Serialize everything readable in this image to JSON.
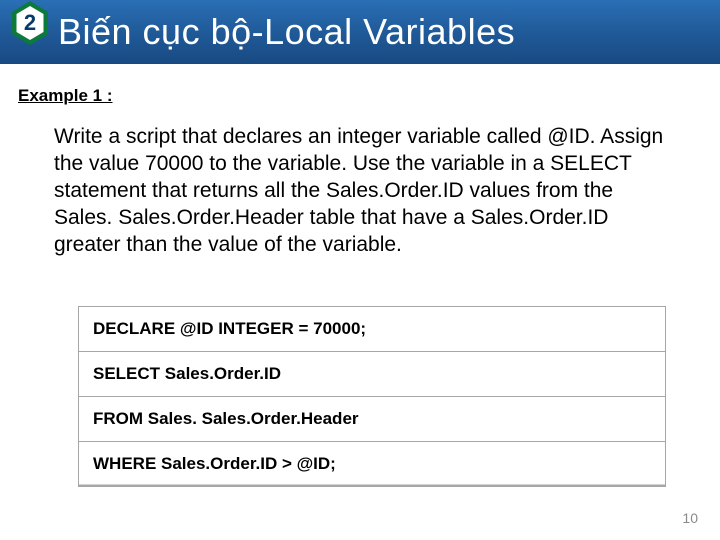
{
  "badge": {
    "number": "2"
  },
  "title": "Biến cục bộ-Local Variables",
  "example_label": "Example 1 :",
  "body_text": "Write a script that declares an integer variable called @ID. Assign the value 70000 to the variable. Use the variable in a SELECT statement that returns all the Sales.Order.ID values from the Sales. Sales.Order.Header table that have a Sales.Order.ID greater than the value of the variable.",
  "code": {
    "lines": [
      "DECLARE @ID INTEGER = 70000;",
      "SELECT Sales.Order.ID",
      "FROM Sales. Sales.Order.Header",
      "WHERE Sales.Order.ID > @ID;"
    ]
  },
  "page_number": "10"
}
